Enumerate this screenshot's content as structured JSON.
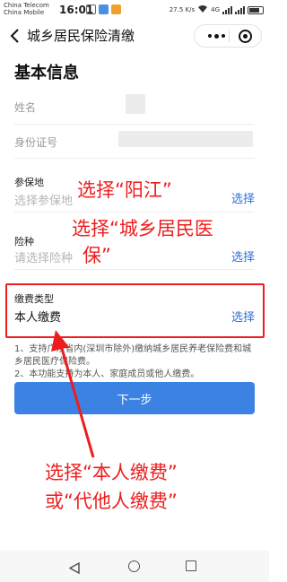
{
  "status_bar": {
    "carrier1": "China Telecom",
    "carrier2": "China Mobile",
    "time": "16:01",
    "speed": "27.5 K/s",
    "network": "4G"
  },
  "nav": {
    "title": "城乡居民保险清缴"
  },
  "form": {
    "section_title": "基本信息",
    "name_label": "姓名",
    "id_label": "身份证号",
    "insured_place_title": "参保地",
    "insured_place_placeholder": "选择参保地",
    "insurance_type_title": "险种",
    "insurance_type_placeholder": "请选择险种",
    "payment_type_title": "缴费类型",
    "payment_type_value": "本人缴费",
    "select_label": "选择"
  },
  "notes": [
    "1、支持广东省内(深圳市除外)缴纳城乡居民养老保险费和城乡居民医疗保险费。",
    "2、本功能支持为本人、家庭成员或他人缴费。"
  ],
  "next_button": "下一步",
  "annotations": {
    "select_yangjiang": "选择“阳江”",
    "select_resident_medical_line1": "选择“城乡居民医",
    "select_resident_medical_line2": "保”",
    "select_payment_line1": "选择“本人缴费”",
    "select_payment_line2": "或“代他人缴费”"
  },
  "colors": {
    "accent": "#3b82e3",
    "link": "#2f6fd8",
    "annotation": "#ee1d1d"
  }
}
